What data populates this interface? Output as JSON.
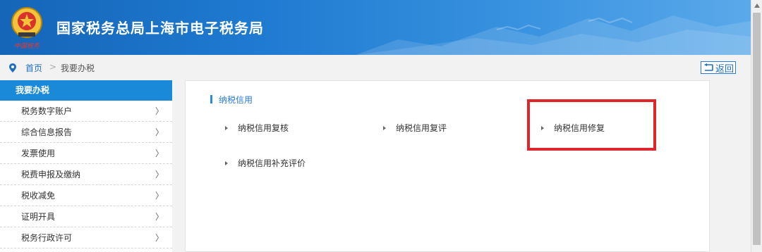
{
  "header": {
    "title": "国家税务总局上海市电子税务局",
    "emblem_signature": "中国税务"
  },
  "breadcrumb": {
    "home": "首页",
    "separator": ">",
    "current": "我要办税",
    "back_label": "返回"
  },
  "sidebar": {
    "header": "我要办税",
    "items": [
      {
        "label": "税务数字账户"
      },
      {
        "label": "综合信息报告"
      },
      {
        "label": "发票使用"
      },
      {
        "label": "税费申报及缴纳"
      },
      {
        "label": "税收减免"
      },
      {
        "label": "证明开具"
      },
      {
        "label": "税务行政许可"
      }
    ],
    "arrow": "〉"
  },
  "main": {
    "section_title": "纳税信用",
    "links": [
      {
        "label": "纳税信用复核"
      },
      {
        "label": "纳税信用复评"
      },
      {
        "label": "纳税信用修复"
      },
      {
        "label": "纳税信用补充评价"
      }
    ]
  },
  "colors": {
    "header_blue": "#1f7bd1",
    "accent": "#1a8ad8",
    "highlight": "#e0242b"
  }
}
